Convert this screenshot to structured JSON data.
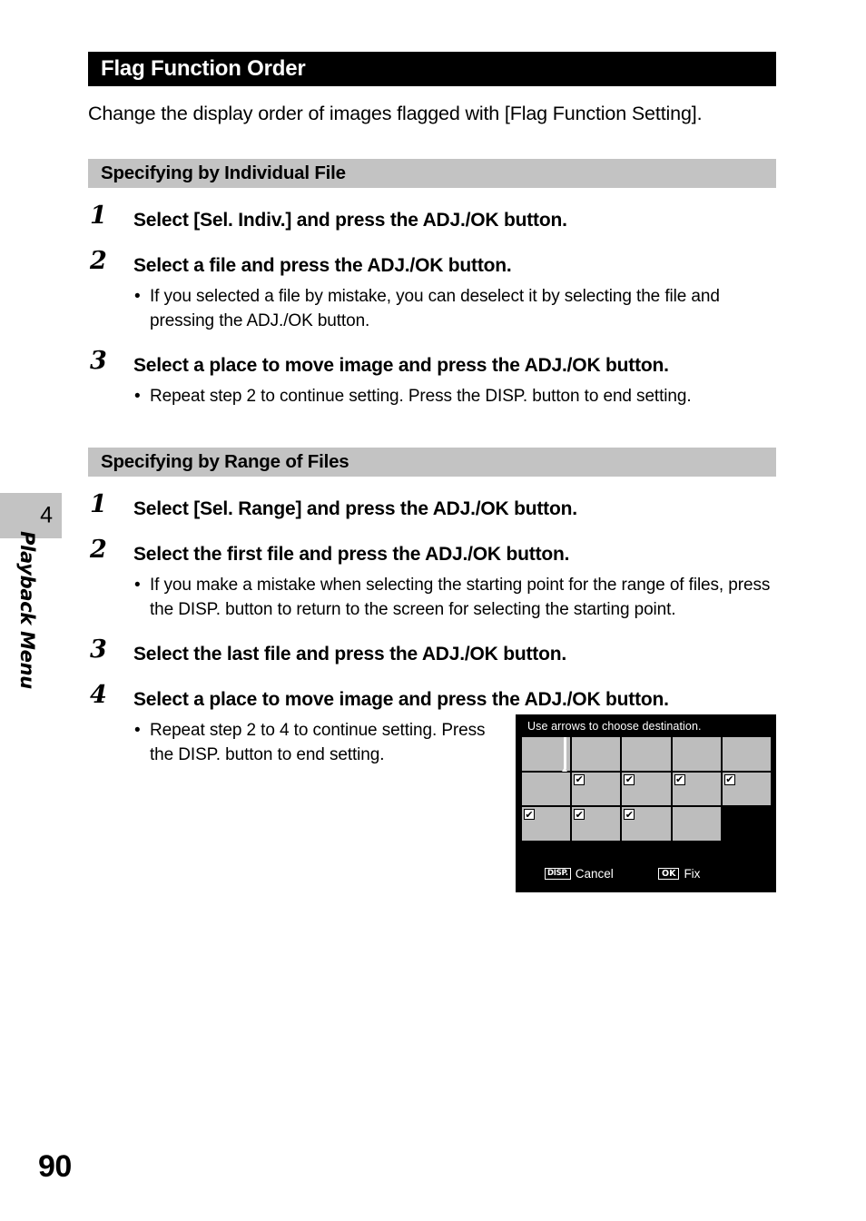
{
  "chapter_tab": {
    "number": "4",
    "label": "Playback Menu"
  },
  "page_number": "90",
  "title": "Flag Function Order",
  "intro": "Change the display order of images flagged with [Flag Function Setting].",
  "sections": [
    {
      "heading": "Specifying by Individual File",
      "steps": [
        {
          "num": "1",
          "text": "Select [Sel. Indiv.] and press the ADJ./OK button.",
          "bullets": []
        },
        {
          "num": "2",
          "text": "Select a file and press the ADJ./OK button.",
          "bullets": [
            "If you selected a file by mistake, you can deselect it by selecting the file and pressing the ADJ./OK button."
          ]
        },
        {
          "num": "3",
          "text": "Select a place to move image and press the ADJ./OK button.",
          "bullets": [
            "Repeat step 2 to continue setting. Press the DISP. button to end setting."
          ]
        }
      ]
    },
    {
      "heading": "Specifying by Range of Files",
      "steps": [
        {
          "num": "1",
          "text": "Select [Sel. Range] and press the ADJ./OK button.",
          "bullets": []
        },
        {
          "num": "2",
          "text": "Select the first file and press the ADJ./OK button.",
          "bullets": [
            "If you make a mistake when selecting the starting point for the range of files, press the DISP. button to return to the screen for selecting the starting point."
          ]
        },
        {
          "num": "3",
          "text": "Select the last file and press the ADJ./OK button.",
          "bullets": []
        },
        {
          "num": "4",
          "text": "Select a place to move image and press the ADJ./OK button.",
          "bullets": [
            "Repeat step 2 to 4 to continue setting. Press the DISP. button to end setting."
          ]
        }
      ]
    }
  ],
  "camera_screen": {
    "title": "Use arrows to choose destination.",
    "bullet_char": "•",
    "check_char": "✔",
    "grid": {
      "columns": 5,
      "rows": 3,
      "cells": [
        {
          "present": true,
          "checked": false
        },
        {
          "present": true,
          "checked": false
        },
        {
          "present": true,
          "checked": false
        },
        {
          "present": true,
          "checked": false
        },
        {
          "present": true,
          "checked": false
        },
        {
          "present": true,
          "checked": false
        },
        {
          "present": true,
          "checked": true
        },
        {
          "present": true,
          "checked": true
        },
        {
          "present": true,
          "checked": true
        },
        {
          "present": true,
          "checked": true
        },
        {
          "present": true,
          "checked": true
        },
        {
          "present": true,
          "checked": true
        },
        {
          "present": true,
          "checked": true
        },
        {
          "present": true,
          "checked": false
        },
        {
          "present": false,
          "checked": false
        }
      ]
    },
    "cancel_badge": "DISP.",
    "cancel_label": "Cancel",
    "fix_badge": "OK",
    "fix_label": "Fix"
  },
  "colors": {
    "title_bar_bg": "#000000",
    "section_bar_bg": "#c3c3c3",
    "tab_bg": "#c3c3c3",
    "thumbnail_gray": "#bdbdbd",
    "screen_bg": "#000000"
  }
}
